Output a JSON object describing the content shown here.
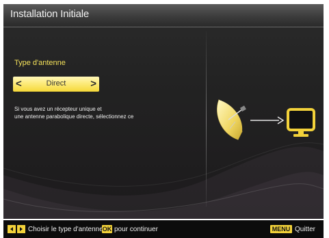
{
  "window": {
    "title": "Installation Initiale"
  },
  "antenna": {
    "label": "Type d'antenne",
    "selected_value": "Direct",
    "left_arrow": "<",
    "right_arrow": ">"
  },
  "help_text": {
    "line1": "Si vous avez un récepteur unique et",
    "line2": "une antenne parabolique directe, sélectionnez ce"
  },
  "footer": {
    "choose_text": "Choisir le type d'antenne",
    "ok_key": "OK",
    "continue_text": "pour continuer",
    "menu_key": "MENU",
    "quit_text": "Quitter"
  },
  "icons": {
    "nav_arrows": "left-right-arrows-icon",
    "satellite": "satellite-dish-icon",
    "tv": "tv-icon",
    "arrow": "arrow-right-icon"
  },
  "colors": {
    "accent": "#f3d23a",
    "label_yellow": "#f4e15a",
    "background": "#232323"
  }
}
